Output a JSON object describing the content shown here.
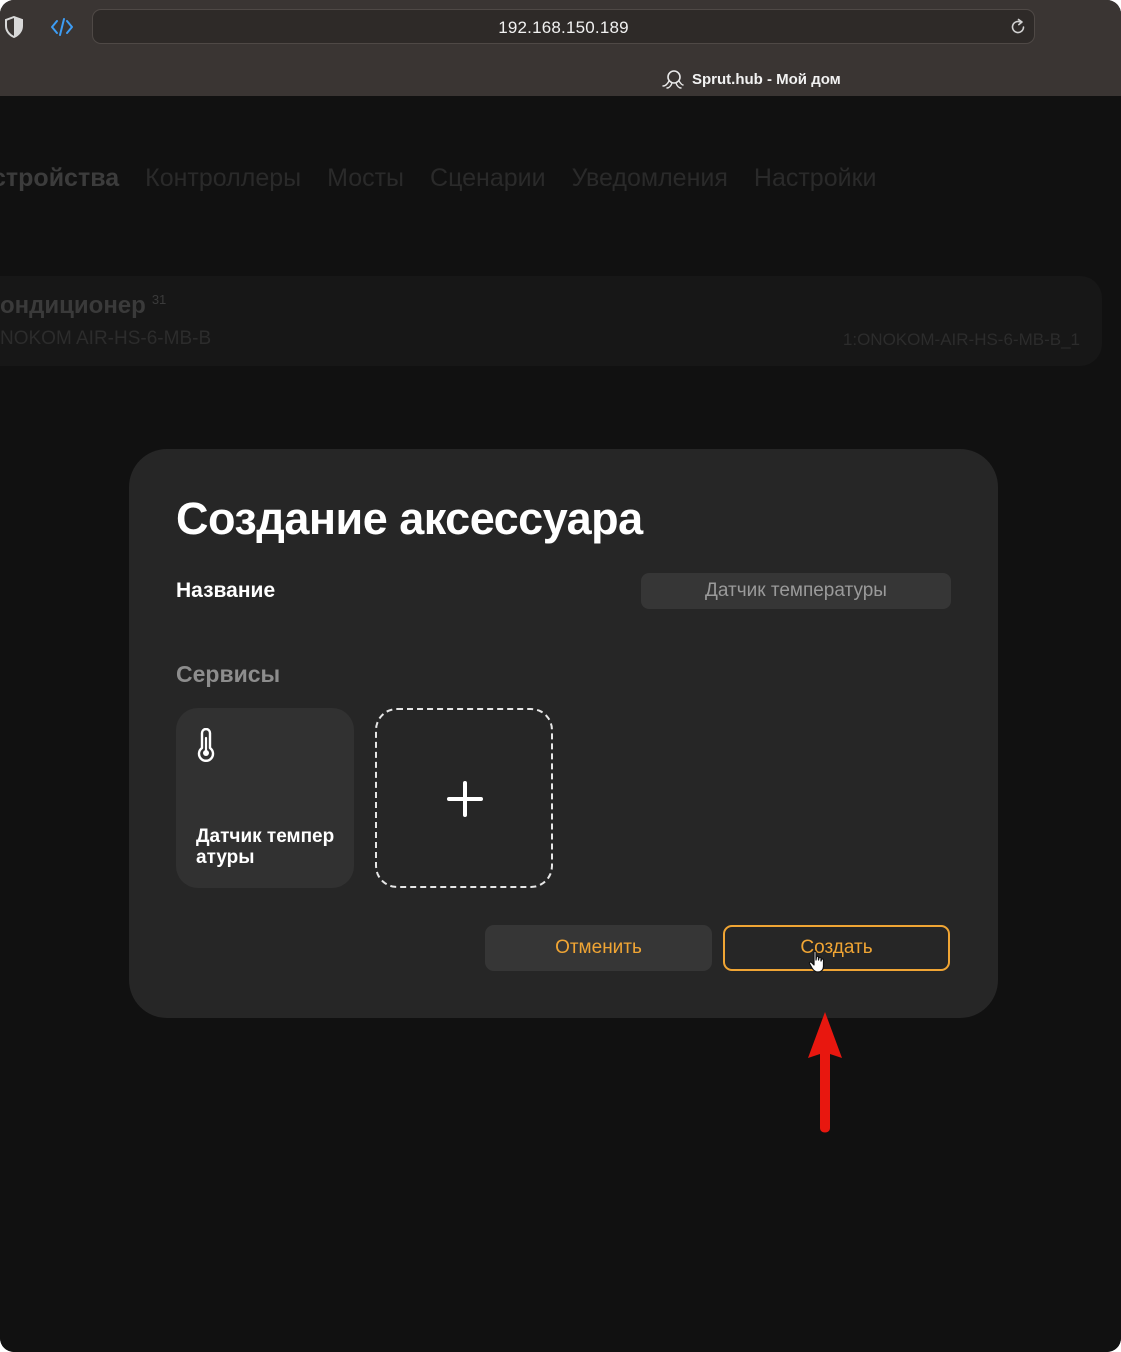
{
  "browser": {
    "url": "192.168.150.189",
    "tab_title": "Sprut.hub - Мой дом"
  },
  "nav": {
    "items": [
      "стройства",
      "Контроллеры",
      "Мосты",
      "Сценарии",
      "Уведомления",
      "Настройки"
    ]
  },
  "device": {
    "name": "ондиционер",
    "count": "31",
    "model": "NOKOM AIR-HS-6-MB-B",
    "id": "1:ONOKOM-AIR-HS-6-MB-B_1"
  },
  "modal": {
    "title": "Создание аксессуара",
    "name_label": "Название",
    "name_placeholder": "Датчик температуры",
    "services_label": "Сервисы",
    "services": [
      {
        "name": "Датчик температуры",
        "icon": "thermometer-icon"
      }
    ],
    "add_icon": "plus-icon",
    "cancel_label": "Отменить",
    "create_label": "Создать"
  },
  "colors": {
    "accent": "#f0a534",
    "modal_bg": "#262626",
    "annotation": "#e8170f"
  }
}
